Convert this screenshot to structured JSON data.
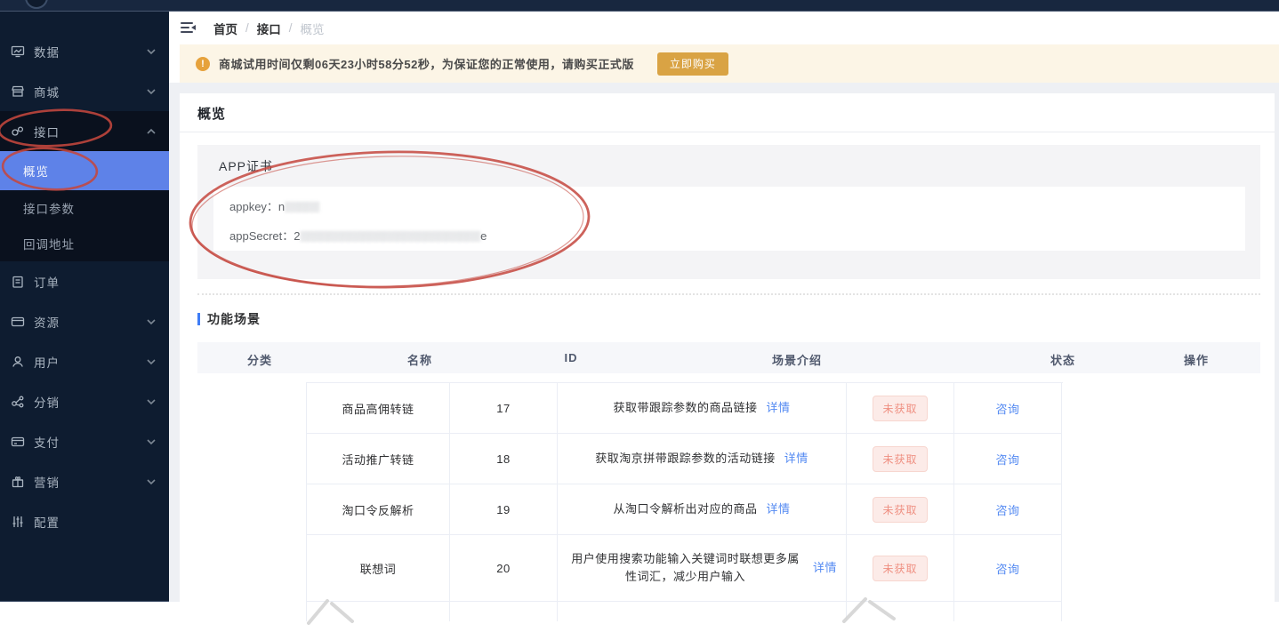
{
  "sidebar": {
    "items": [
      {
        "label": "数据",
        "icon": "monitor-icon",
        "chevron": "down"
      },
      {
        "label": "商城",
        "icon": "shop-icon",
        "chevron": "down"
      },
      {
        "label": "接口",
        "icon": "api-icon",
        "chevron": "up"
      },
      {
        "label": "订单",
        "icon": "order-icon",
        "chevron": ""
      },
      {
        "label": "资源",
        "icon": "resource-icon",
        "chevron": "down"
      },
      {
        "label": "用户",
        "icon": "user-icon",
        "chevron": "down"
      },
      {
        "label": "分销",
        "icon": "distribution-icon",
        "chevron": "down"
      },
      {
        "label": "支付",
        "icon": "payment-icon",
        "chevron": "down"
      },
      {
        "label": "营销",
        "icon": "marketing-icon",
        "chevron": "down"
      },
      {
        "label": "配置",
        "icon": "config-icon",
        "chevron": ""
      }
    ],
    "submenu": [
      {
        "label": "概览",
        "active": true
      },
      {
        "label": "接口参数",
        "active": false
      },
      {
        "label": "回调地址",
        "active": false
      }
    ]
  },
  "header": {
    "breadcrumb": [
      "首页",
      "接口",
      "概览"
    ],
    "separator": "/"
  },
  "alert": {
    "message": "商城试用时间仅剩06天23小时58分52秒，为保证您的正常使用，请购买正式版",
    "icon": "exclamation-circle-icon",
    "button_label": "立即购买"
  },
  "page": {
    "title": "概览"
  },
  "certificate": {
    "title": "APP证书",
    "appkey_label": "appkey：",
    "appkey_prefix": "n",
    "appkey_masked": "▒▒▒▒▒",
    "appsecret_label": "appSecret：",
    "appsecret_prefix": "2",
    "appsecret_masked": "▒▒▒▒▒▒▒▒▒▒▒▒▒▒▒▒▒▒▒▒▒▒▒▒▒▒",
    "appsecret_suffix": "e"
  },
  "scenes": {
    "title": "功能场景",
    "columns": [
      "分类",
      "名称",
      "ID",
      "场景介绍",
      "状态",
      "操作"
    ],
    "detail_label": "详情",
    "rows": [
      {
        "name": "商品高佣转链",
        "id": "17",
        "desc": "获取带跟踪参数的商品链接",
        "status": "未获取",
        "action": "咨询"
      },
      {
        "name": "活动推广转链",
        "id": "18",
        "desc": "获取淘京拼带跟踪参数的活动链接",
        "status": "未获取",
        "action": "咨询"
      },
      {
        "name": "淘口令反解析",
        "id": "19",
        "desc": "从淘口令解析出对应的商品",
        "status": "未获取",
        "action": "咨询"
      },
      {
        "name": "联想词",
        "id": "20",
        "desc": "用户使用搜索功能输入关键词时联想更多属性词汇，减少用户输入",
        "status": "未获取",
        "action": "咨询"
      }
    ]
  },
  "colors": {
    "sidebar_bg": "#0e1c30",
    "submenu_bg": "#0a111e",
    "selected_blue": "#5e82e8",
    "link_blue": "#548af2",
    "section_bar_blue": "#3f7df6",
    "alert_bg": "#fcf5e6",
    "alert_orange": "#e6a23c",
    "buy_button": "#d9a344",
    "badge_bg": "#fcebe8",
    "badge_text": "#ef9082",
    "annotation_red": "#c4473e",
    "page_bg": "#eef0f4"
  }
}
